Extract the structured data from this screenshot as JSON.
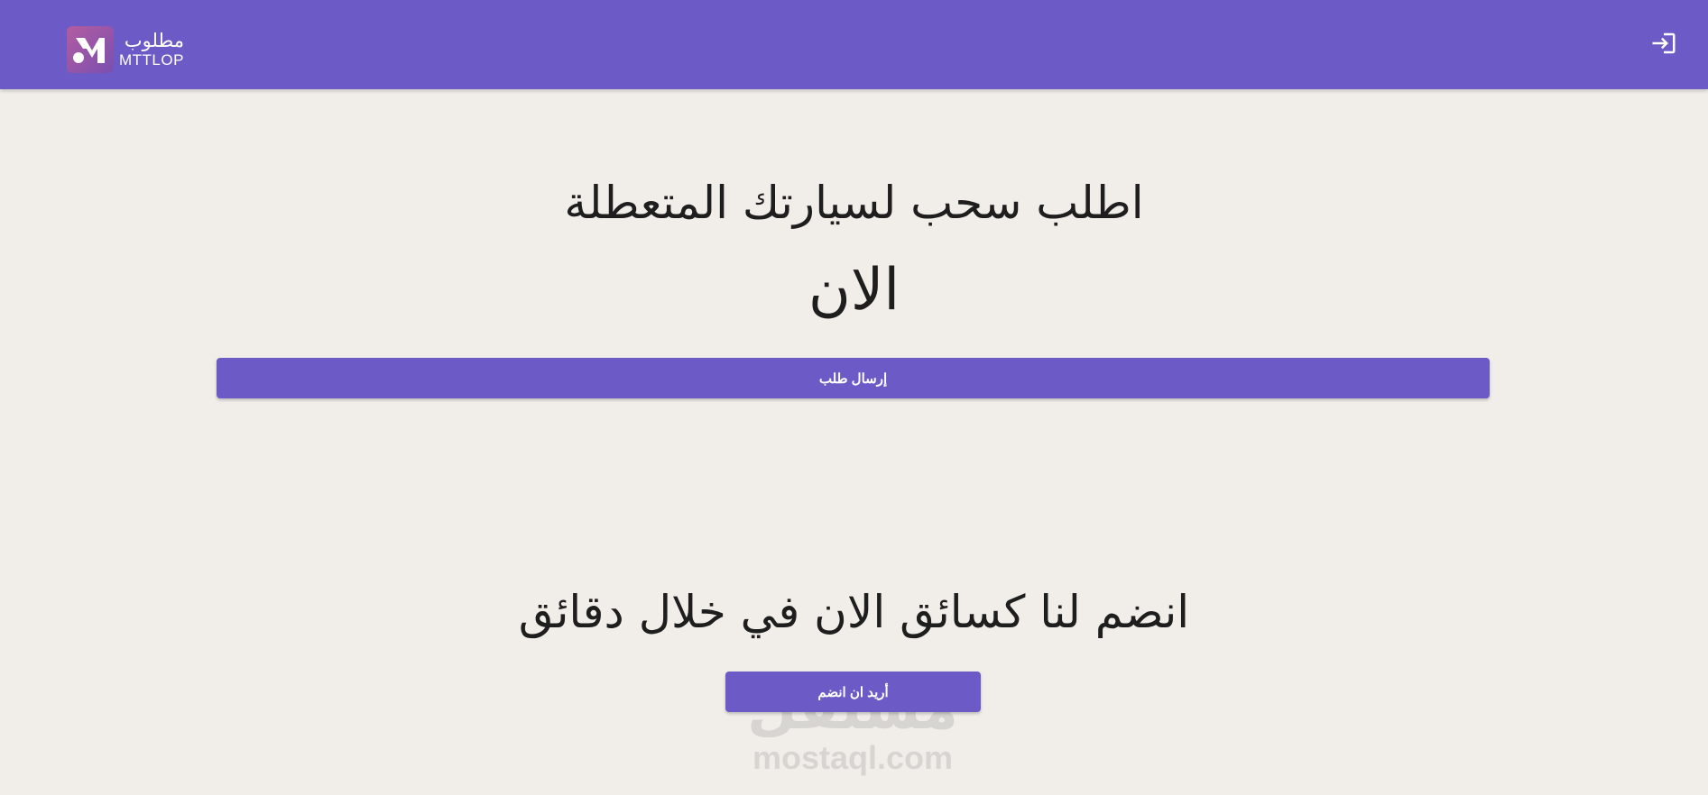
{
  "header": {
    "logo_arabic": "مطلوب",
    "logo_english": "MTTLOP",
    "login_icon": "login-icon",
    "background_color": "#6c5bc6"
  },
  "hero": {
    "headline_line1": "اطلب سحب لسيارتك المتعطلة",
    "headline_line2": "الان",
    "send_request_label": "إرسال طلب"
  },
  "join": {
    "headline": "انضم لنا كسائق الان في خلال دقائق",
    "join_label": "أريد ان انضم"
  },
  "watermark": {
    "arabic": "مستقل",
    "english": "mostaql.com"
  },
  "colors": {
    "accent": "#6c5bc6",
    "page_background": "#f1eeea",
    "text": "#1e1e1e"
  }
}
